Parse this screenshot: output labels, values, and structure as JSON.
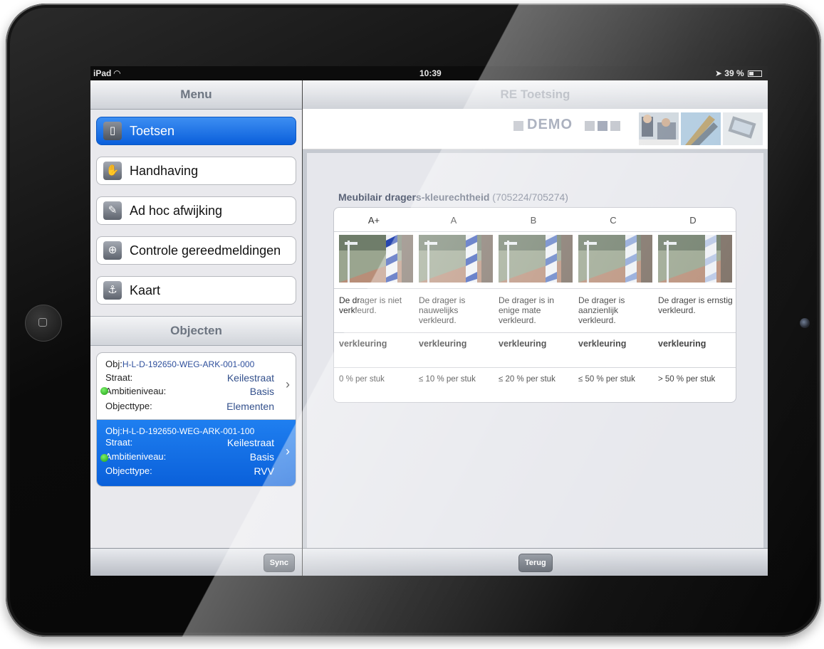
{
  "statusbar": {
    "device": "iPad",
    "time": "10:39",
    "battery": "39 %"
  },
  "left": {
    "title": "Menu",
    "menu": [
      {
        "label": "Toetsen",
        "active": true
      },
      {
        "label": "Handhaving",
        "active": false
      },
      {
        "label": "Ad hoc afwijking",
        "active": false
      },
      {
        "label": "Controle gereedmeldingen",
        "active": false
      },
      {
        "label": "Kaart",
        "active": false
      }
    ],
    "objects_title": "Objecten",
    "objects": [
      {
        "prefix": "Obj:",
        "id": "H-L-D-192650-WEG-ARK-001-000",
        "straat_k": "Straat:",
        "straat_v": "Keilestraat",
        "ambitie_k": "Ambitieniveau:",
        "ambitie_v": "Basis",
        "type_k": "Objecttype:",
        "type_v": "Elementen",
        "selected": false
      },
      {
        "prefix": "Obj:",
        "id": "H-L-D-192650-WEG-ARK-001-100",
        "straat_k": "Straat:",
        "straat_v": "Keilestraat",
        "ambitie_k": "Ambitieniveau:",
        "ambitie_v": "Basis",
        "type_k": "Objecttype:",
        "type_v": "RVV",
        "selected": true
      }
    ],
    "sync_button": "Sync"
  },
  "right": {
    "title": "RE Toetsing",
    "banner_text": "DEMO",
    "heading": "Meubilair dragers-kleurechtheid",
    "heading_code": "(705224/705274)",
    "columns": [
      {
        "grade": "A+",
        "desc": "De drager is niet verkleurd.",
        "level": "verkleuring",
        "pct": "0 % per stuk"
      },
      {
        "grade": "A",
        "desc": "De drager is nauwelijks verkleurd.",
        "level": "verkleuring",
        "pct": "≤ 10 % per stuk"
      },
      {
        "grade": "B",
        "desc": "De drager is in enige mate verkleurd.",
        "level": "verkleuring",
        "pct": "≤ 20 % per stuk"
      },
      {
        "grade": "C",
        "desc": "De drager is aanzienlijk verkleurd.",
        "level": "verkleuring",
        "pct": "≤ 50 % per stuk"
      },
      {
        "grade": "D",
        "desc": "De drager is ernstig verkleurd.",
        "level": "verkleuring",
        "pct": "> 50 % per stuk"
      }
    ],
    "back_button": "Terug"
  },
  "colors": {
    "accent": "#0a60da",
    "nav_text": "#6d7581",
    "status_ok": "#1d9e12"
  },
  "icons": [
    "wifi-icon",
    "location-arrow-icon",
    "battery-icon",
    "toetsen-icon",
    "handhaving-icon",
    "pencil-icon",
    "magnifier-plus-icon",
    "map-pin-icon",
    "status-dot-icon",
    "chevron-right-icon"
  ]
}
